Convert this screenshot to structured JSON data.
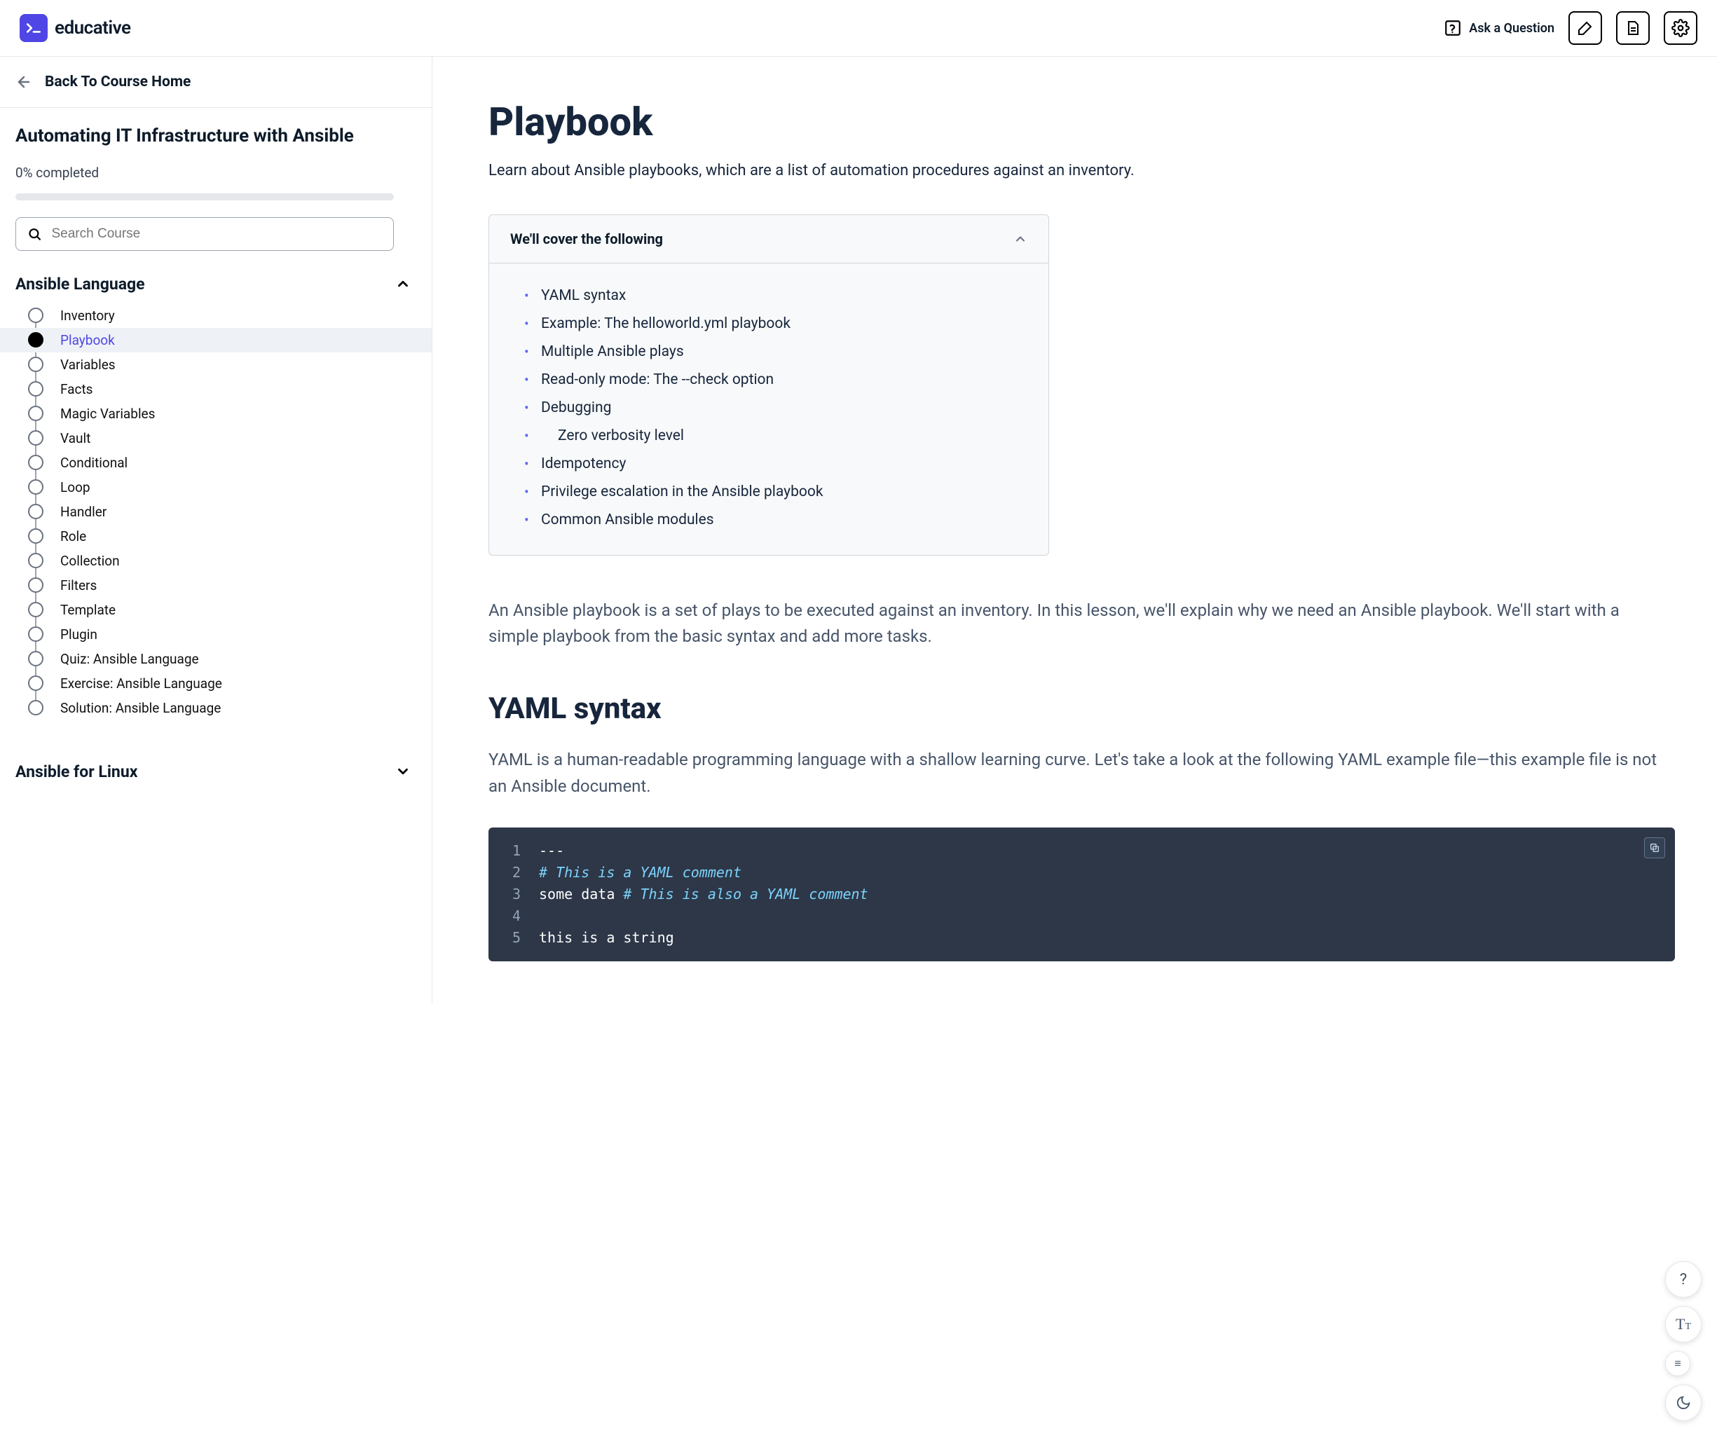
{
  "brand": {
    "name": "educative"
  },
  "topbar": {
    "ask_label": "Ask a Question"
  },
  "sidebar": {
    "back_label": "Back To Course Home",
    "course_title": "Automating IT Infrastructure with Ansible",
    "progress_text": "0% completed",
    "search_placeholder": "Search Course",
    "section_title": "Ansible Language",
    "lessons": [
      "Inventory",
      "Playbook",
      "Variables",
      "Facts",
      "Magic Variables",
      "Vault",
      "Conditional",
      "Loop",
      "Handler",
      "Role",
      "Collection",
      "Filters",
      "Template",
      "Plugin",
      "Quiz: Ansible Language",
      "Exercise: Ansible Language",
      "Solution: Ansible Language"
    ],
    "active_index": 1,
    "collapsed_section": "Ansible for Linux"
  },
  "content": {
    "title": "Playbook",
    "subtitle": "Learn about Ansible playbooks, which are a list of automation procedures against an inventory.",
    "cover_title": "We'll cover the following",
    "toc": [
      {
        "label": "YAML syntax"
      },
      {
        "label": "Example: The helloworld.yml playbook"
      },
      {
        "label": "Multiple Ansible plays"
      },
      {
        "label": "Read-only mode: The --check option"
      },
      {
        "label": "Debugging",
        "children": [
          "Zero verbosity level"
        ]
      },
      {
        "label": "Idempotency"
      },
      {
        "label": "Privilege escalation in the Ansible playbook"
      },
      {
        "label": "Common Ansible modules"
      }
    ],
    "intro": "An Ansible playbook is a set of plays to be executed against an inventory. In this lesson, we'll explain why we need an Ansible playbook. We'll start with a simple playbook from the basic syntax and add more tasks.",
    "h2": "YAML syntax",
    "p2": "YAML is a human-readable programming language with a shallow learning curve. Let's take a look at the following YAML example file—this example file is not an Ansible document.",
    "code_lines": [
      {
        "n": 1,
        "segs": [
          {
            "t": "---",
            "c": "d"
          }
        ]
      },
      {
        "n": 2,
        "segs": [
          {
            "t": "# This is a YAML comment",
            "c": "c"
          }
        ]
      },
      {
        "n": 3,
        "segs": [
          {
            "t": "some data ",
            "c": "d"
          },
          {
            "t": "# This is also a YAML comment",
            "c": "c"
          }
        ]
      },
      {
        "n": 4,
        "segs": []
      },
      {
        "n": 5,
        "segs": [
          {
            "t": "this is a string",
            "c": "d"
          }
        ]
      }
    ]
  }
}
